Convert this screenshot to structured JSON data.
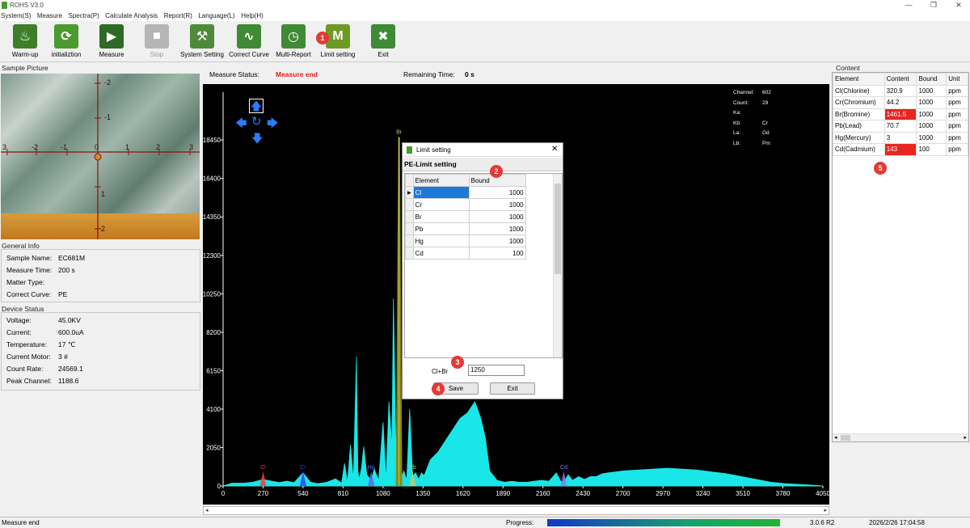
{
  "window": {
    "title": "ROHS V3.0",
    "minimize": "—",
    "restore": "❐",
    "close": "✕"
  },
  "menu": [
    "System(S)",
    "Measure",
    "Spectra(P)",
    "Calculate Analysis",
    "Report(R)",
    "Language(L)",
    "Help(H)"
  ],
  "toolbar": [
    {
      "label": "Warm-up",
      "icon": "flame-icon",
      "color": "#3f7f2a",
      "glyph": "♨"
    },
    {
      "label": "initializtion",
      "icon": "refresh-icon",
      "color": "#4a9a2e",
      "glyph": "⟳"
    },
    {
      "label": "Measure",
      "icon": "play-icon",
      "color": "#2d6a25",
      "glyph": "▶"
    },
    {
      "label": "Stop",
      "icon": "stop-icon",
      "color": "#b5b5b5",
      "glyph": "■"
    },
    {
      "label": "System Setting",
      "icon": "hammer-icon",
      "color": "#4f8a3a",
      "glyph": "⚒"
    },
    {
      "label": "Correct Curve",
      "icon": "curve-icon",
      "color": "#3f8a34",
      "glyph": "∿"
    },
    {
      "label": "Multi-Report",
      "icon": "clock-icon",
      "color": "#3f8a34",
      "glyph": "◷"
    },
    {
      "label": "Limit setting",
      "icon": "limit-icon",
      "color": "#6c9a25",
      "glyph": "M"
    },
    {
      "label": "Exit",
      "icon": "exit-icon",
      "color": "#3f8a34",
      "glyph": "✖"
    }
  ],
  "badges": {
    "b1": "1",
    "b2": "2",
    "b3": "3",
    "b4": "4",
    "b5": "5"
  },
  "sample": {
    "title": "Sample Picture",
    "axis_labels": [
      "3",
      "-2",
      "-1",
      "0",
      "1",
      "2",
      "3",
      "-2",
      "-1",
      "1",
      "2"
    ]
  },
  "general_info": {
    "title": "General Info",
    "rows": [
      {
        "k": "Sample Name:",
        "v": "EC681M"
      },
      {
        "k": "Measure Time:",
        "v": "200 s"
      },
      {
        "k": "Matter Type:",
        "v": ""
      },
      {
        "k": "Correct Curve:",
        "v": "PE"
      }
    ]
  },
  "device_status": {
    "title": "Device Status",
    "rows": [
      {
        "k": "Voltage:",
        "v": "45.0KV"
      },
      {
        "k": "Current:",
        "v": "600.0uA"
      },
      {
        "k": "Temperature:",
        "v": "17 ℃"
      },
      {
        "k": "Current Motor:",
        "v": "3 #"
      },
      {
        "k": "Count Rate:",
        "v": "24569.1"
      },
      {
        "k": "Peak Channel:",
        "v": "1188.6"
      }
    ]
  },
  "status": {
    "measure_label": "Measure Status:",
    "measure_value": "Measure end",
    "remaining_label": "Remaining Time:",
    "remaining_value": "0 s"
  },
  "info_overlay": [
    {
      "k": "Channel:",
      "v": "602"
    },
    {
      "k": "Count:",
      "v": "29"
    },
    {
      "k": "Ka:",
      "v": ""
    },
    {
      "k": "Kb:",
      "v": "Cr"
    },
    {
      "k": "La:",
      "v": "Gd"
    },
    {
      "k": "Lb:",
      "v": "Pm"
    }
  ],
  "chart_data": {
    "type": "area",
    "x": [
      0,
      60,
      140,
      200,
      270,
      330,
      380,
      430,
      480,
      540,
      590,
      640,
      700,
      760,
      800,
      820,
      840,
      860,
      880,
      900,
      910,
      920,
      935,
      950,
      970,
      1000,
      1020,
      1050,
      1080,
      1100,
      1120,
      1140,
      1150,
      1170,
      1188,
      1200,
      1220,
      1240,
      1260,
      1280,
      1300,
      1320,
      1340,
      1350,
      1360,
      1380,
      1400,
      1450,
      1500,
      1550,
      1600,
      1650,
      1700,
      1740,
      1770,
      1800,
      1850,
      1900,
      1950,
      2000,
      2050,
      2100,
      2150,
      2200,
      2250,
      2280,
      2300,
      2330,
      2360,
      2400,
      2440,
      2480,
      2520,
      2560,
      2600,
      2700,
      2800,
      2900,
      3000,
      3100,
      3200,
      3300,
      3400,
      3500,
      3600,
      3700,
      3800,
      3900,
      4000,
      4050
    ],
    "y": [
      0,
      150,
      150,
      200,
      350,
      250,
      180,
      260,
      180,
      700,
      200,
      120,
      200,
      380,
      150,
      1200,
      200,
      2200,
      300,
      6900,
      800,
      350,
      1000,
      2100,
      600,
      300,
      900,
      300,
      3400,
      300,
      4500,
      2000,
      10000,
      400,
      1200,
      300,
      800,
      300,
      4100,
      500,
      700,
      350,
      700,
      600,
      600,
      1000,
      1400,
      1800,
      2400,
      3000,
      3600,
      3900,
      4500,
      3600,
      2600,
      800,
      300,
      200,
      250,
      200,
      200,
      250,
      300,
      250,
      700,
      250,
      200,
      600,
      300,
      500,
      350,
      500,
      500,
      650,
      700,
      800,
      850,
      900,
      950,
      900,
      850,
      750,
      650,
      500,
      350,
      200,
      120,
      80,
      40,
      0
    ],
    "br_peak": {
      "x": 1188,
      "y": 18600
    },
    "xticks": [
      0,
      270,
      540,
      810,
      1080,
      1350,
      1620,
      1890,
      2160,
      2430,
      2700,
      2970,
      3240,
      3510,
      3780,
      4050
    ],
    "yticks": [
      0,
      2050,
      4100,
      6150,
      8200,
      10250,
      12300,
      14350,
      16400,
      18450
    ],
    "xlim": [
      0,
      4050
    ],
    "ylim": [
      0,
      21000
    ],
    "markers": [
      {
        "label": "Cl",
        "x": 270,
        "color": "#ff3b3b"
      },
      {
        "label": "Cr",
        "x": 540,
        "color": "#3b3bff"
      },
      {
        "label": "Hg",
        "x": 1000,
        "color": "#6464ff"
      },
      {
        "label": "Br",
        "x": 1188,
        "color": "#c8c864"
      },
      {
        "label": "Pb",
        "x": 1280,
        "color": "#c8c864"
      },
      {
        "label": "Cd",
        "x": 2300,
        "color": "#8a7cff"
      }
    ],
    "fill": "#19e6e6",
    "highlight_fill": "#8a8a1a"
  },
  "dialog": {
    "title": "Limit setting",
    "heading": "PE-Limit setting",
    "columns": [
      "Element",
      "Bound"
    ],
    "rows": [
      {
        "e": "Cl",
        "b": "1000"
      },
      {
        "e": "Cr",
        "b": "1000"
      },
      {
        "e": "Br",
        "b": "1000"
      },
      {
        "e": "Pb",
        "b": "1000"
      },
      {
        "e": "Hg",
        "b": "1000"
      },
      {
        "e": "Cd",
        "b": "100"
      }
    ],
    "sum_label": "Cl+Br",
    "sum_value": "1250",
    "save": "Save",
    "exit": "Exit"
  },
  "content": {
    "title": "Content",
    "columns": [
      "Element",
      "Content",
      "Bound",
      "Unit"
    ],
    "rows": [
      {
        "element": "Cl(Chlorine)",
        "content": "320.9",
        "bound": "1000",
        "unit": "ppm",
        "flag": false
      },
      {
        "element": "Cr(Chromium)",
        "content": "44.2",
        "bound": "1000",
        "unit": "ppm",
        "flag": false
      },
      {
        "element": "Br(Bromine)",
        "content": "1461.5",
        "bound": "1000",
        "unit": "ppm",
        "flag": true
      },
      {
        "element": "Pb(Lead)",
        "content": "70.7",
        "bound": "1000",
        "unit": "ppm",
        "flag": false
      },
      {
        "element": "Hg(Mercury)",
        "content": "3",
        "bound": "1000",
        "unit": "ppm",
        "flag": false
      },
      {
        "element": "Cd(Cadmium)",
        "content": "143",
        "bound": "100",
        "unit": "ppm",
        "flag": true
      }
    ],
    "flag_color": "#e8261f"
  },
  "statusbar": {
    "left": "Measure end",
    "progress_label": "Progress:",
    "progress": 1.0,
    "version": "3.0.6 R2",
    "datetime": "2026/2/26 17:04:58"
  }
}
